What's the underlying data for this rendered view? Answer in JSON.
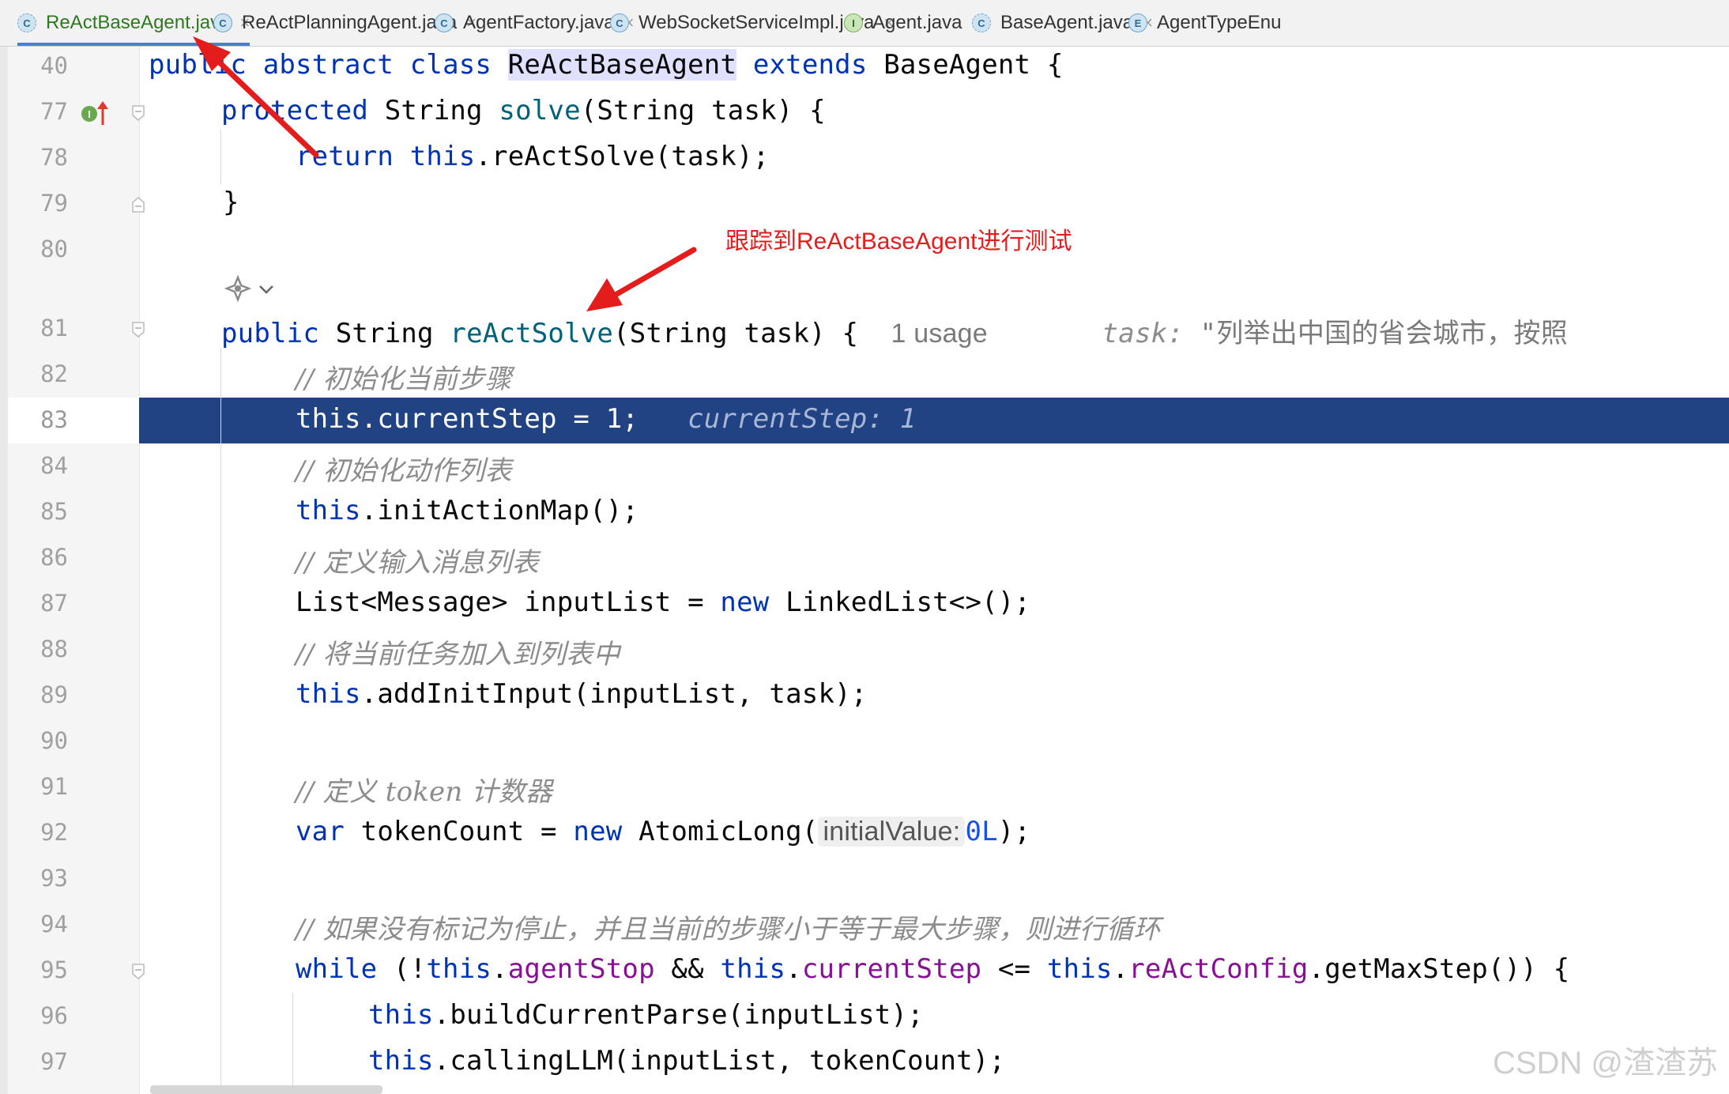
{
  "tabs": [
    {
      "label": "ReActBaseAgent.java",
      "icon": "class-abstract-icon",
      "letter": "C",
      "active": true
    },
    {
      "label": "ReActPlanningAgent.java",
      "icon": "class-icon",
      "letter": "C"
    },
    {
      "label": "AgentFactory.java",
      "icon": "class-icon",
      "letter": "C"
    },
    {
      "label": "WebSocketServiceImpl.java",
      "icon": "class-icon",
      "letter": "C"
    },
    {
      "label": "Agent.java",
      "icon": "interface-icon",
      "letter": "I"
    },
    {
      "label": "BaseAgent.java",
      "icon": "class-abstract-icon",
      "letter": "C"
    },
    {
      "label": "AgentTypeEnu",
      "icon": "enum-icon",
      "letter": "E"
    }
  ],
  "gutter": {
    "line_numbers": [
      "40",
      "77",
      "78",
      "79",
      "80",
      "81",
      "82",
      "83",
      "84",
      "85",
      "86",
      "87",
      "88",
      "89",
      "90",
      "91",
      "92",
      "93",
      "94",
      "95",
      "96",
      "97"
    ],
    "current_line": "83",
    "override_marker": "I↑"
  },
  "code": {
    "l40": {
      "t1": "public",
      "t2": "abstract",
      "t3": "class",
      "t4": "ReActBaseAgent",
      "t5": "extends",
      "t6": "BaseAgent {"
    },
    "l77": {
      "t1": "protected",
      "t2": "String",
      "t3": "solve",
      "t4": "(String task) {"
    },
    "l78": {
      "t1": "return",
      "t2": "this",
      "t3": ".reActSolve(task);"
    },
    "l79": {
      "t1": "}"
    },
    "l81": {
      "t1": "public",
      "t2": "String",
      "t3": "reActSolve",
      "t4": "(String task) {",
      "usage": "1 usage",
      "dbg_name": "task:",
      "dbg_val": "\"列举出中国的省会城市，按照"
    },
    "l82": {
      "t1": "// 初始化当前步骤"
    },
    "l83": {
      "t1": "this.currentStep = 1;",
      "dbg": "currentStep: 1"
    },
    "l84": {
      "t1": "// 初始化动作列表"
    },
    "l85": {
      "t1": "this",
      "t2": ".initActionMap();"
    },
    "l86": {
      "t1": "// 定义输入消息列表"
    },
    "l87": {
      "t1": "List<Message> inputList = ",
      "t2": "new",
      "t3": " LinkedList<>();"
    },
    "l88": {
      "t1": "// 将当前任务加入到列表中"
    },
    "l89": {
      "t1": "this",
      "t2": ".addInitInput(inputList, task);"
    },
    "l91": {
      "t1": "// 定义 token 计数器"
    },
    "l92": {
      "t1": "var",
      "t2": " tokenCount = ",
      "t3": "new",
      "t4": " AtomicLong(",
      "hint": "initialValue:",
      "t5": "0L",
      "t6": ");"
    },
    "l94": {
      "t1": "// 如果没有标记为停止，并且当前的步骤小于等于最大步骤，则进行循环"
    },
    "l95": {
      "t1": "while",
      "t2": " (!",
      "t3": "this",
      "t4": ".",
      "t5": "agentStop",
      "t6": " && ",
      "t7": "this",
      "t8": ".",
      "t9": "currentStep",
      "t10": " <= ",
      "t11": "this",
      "t12": ".",
      "t13": "reActConfig",
      "t14": ".getMaxStep()) {"
    },
    "l96": {
      "t1": "this",
      "t2": ".buildCurrentParse(inputList);"
    },
    "l97": {
      "t1": "this",
      "t2": ".callingLLM(inputList, tokenCount);"
    }
  },
  "annotation": "跟踪到ReActBaseAgent进行测试",
  "watermark": "CSDN @渣渣苏",
  "colors": {
    "keyword": "#0033b3",
    "method": "#00627a",
    "field": "#871094",
    "number": "#1750eb",
    "comment": "#8c8c8c",
    "current_line": "#214283",
    "annotation": "#e51c1c"
  }
}
